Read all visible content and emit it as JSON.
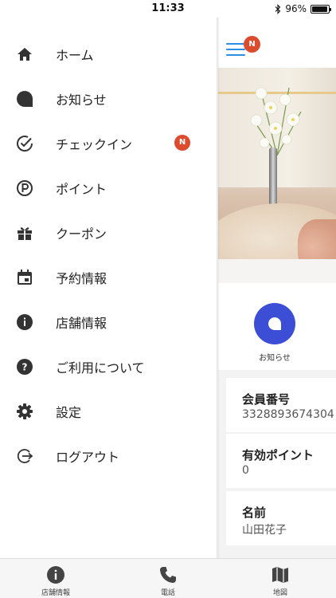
{
  "status_bar": {
    "time": "11:33",
    "battery": "96%",
    "battery_level": 0.96
  },
  "drawer": {
    "items": [
      {
        "label": "ホーム",
        "icon": "home-icon"
      },
      {
        "label": "お知らせ",
        "icon": "chat-bubble-icon"
      },
      {
        "label": "チェックイン",
        "icon": "check-circle-icon",
        "badge": "N"
      },
      {
        "label": "ポイント",
        "icon": "point-icon"
      },
      {
        "label": "クーポン",
        "icon": "gift-icon"
      },
      {
        "label": "予約情報",
        "icon": "calendar-icon"
      },
      {
        "label": "店舗情報",
        "icon": "info-icon"
      },
      {
        "label": "ご利用について",
        "icon": "help-icon"
      },
      {
        "label": "設定",
        "icon": "gear-icon"
      },
      {
        "label": "ログアウト",
        "icon": "logout-icon"
      }
    ]
  },
  "header": {
    "menu_badge": "N",
    "accent_color": "#2b8de3",
    "badge_color": "#dc4b2d"
  },
  "quick_action": {
    "label": "お知らせ",
    "color": "#3c4ed6"
  },
  "member": {
    "fields": [
      {
        "label": "会員番号",
        "value": "3328893674304"
      },
      {
        "label": "有効ポイント",
        "value": "0"
      },
      {
        "label": "名前",
        "value": "山田花子"
      }
    ]
  },
  "tabbar": {
    "tabs": [
      {
        "label": "店舗情報",
        "icon": "info-icon"
      },
      {
        "label": "電話",
        "icon": "phone-icon"
      },
      {
        "label": "地図",
        "icon": "map-icon"
      }
    ]
  }
}
